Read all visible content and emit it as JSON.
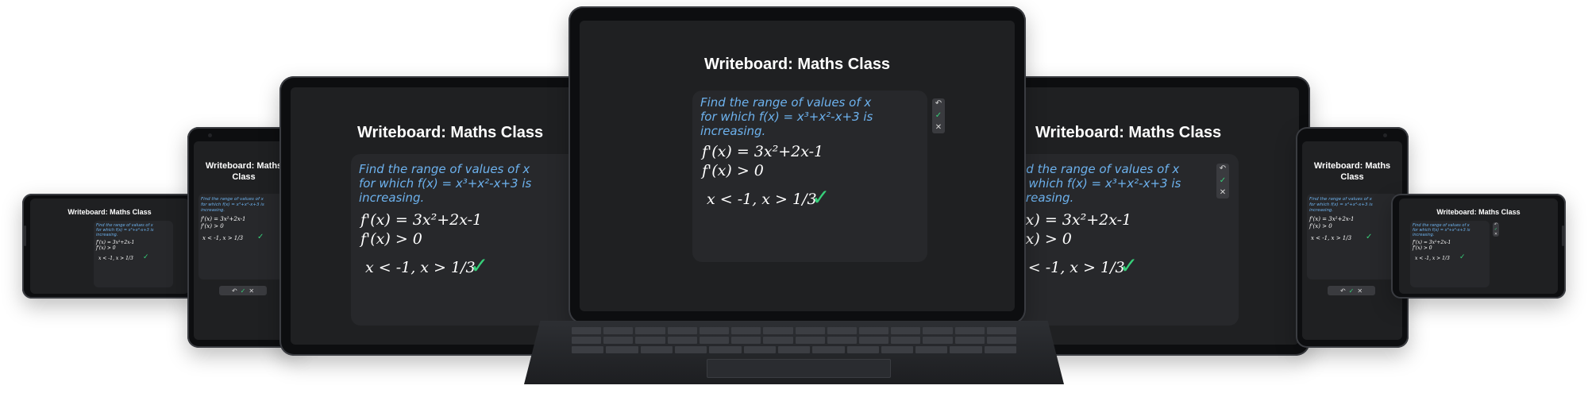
{
  "app": {
    "title": "Writeboard: Maths Class",
    "title_small": "Writeboard: Maths Class"
  },
  "question": {
    "line1": "Find the range of values of x",
    "line2": "for which f(x) = x³+x²-x+3 is",
    "line3": "increasing."
  },
  "working": {
    "derivative": "f'(x) = 3x²+2x-1",
    "condition": "f'(x) > 0",
    "answer": "x < -1,  x > 1/3"
  },
  "toolbar": {
    "undo_icon": "undo-icon",
    "check_icon": "check-icon",
    "close_icon": "close-icon",
    "undo_glyph": "↶",
    "check_glyph": "✓",
    "close_glyph": "✕",
    "tick_glyph": "✓"
  },
  "colors": {
    "question_text": "#6db2ee",
    "working_text": "#ffffff",
    "tick": "#37d07a",
    "screen": "#1f2022",
    "board": "#27282b"
  }
}
